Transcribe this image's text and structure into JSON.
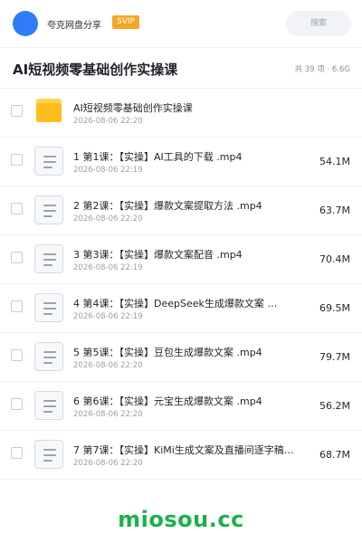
{
  "header": {
    "user_name": "夸克网盘分享",
    "badge": "SVIP",
    "search_placeholder": "搜索"
  },
  "folder": {
    "title": "AI短视频零基础创作实操课",
    "stats": "共 39 项 · 6.6G"
  },
  "items": [
    {
      "type": "folder",
      "name": "AI短视频零基础创作实操课",
      "date": "2026-08-06 22:20",
      "size": ""
    },
    {
      "type": "file",
      "name": "1 第1课：【实操】AI工具的下载 .mp4",
      "date": "2026-08-06 22:19",
      "size": "54.1M"
    },
    {
      "type": "file",
      "name": "2 第2课：【实操】爆款文案提取方法 .mp4",
      "date": "2026-08-06 22:20",
      "size": "63.7M"
    },
    {
      "type": "file",
      "name": "3 第3课：【实操】爆款文案配音 .mp4",
      "date": "2026-08-06 22:19",
      "size": "70.4M"
    },
    {
      "type": "file",
      "name": "4 第4课：【实操】DeepSeek生成爆款文案 …",
      "date": "2026-08-06 22:19",
      "size": "69.5M"
    },
    {
      "type": "file",
      "name": "5 第5课：【实操】豆包生成爆款文案 .mp4",
      "date": "2026-08-06 22:20",
      "size": "79.7M"
    },
    {
      "type": "file",
      "name": "6 第6课：【实操】元宝生成爆款文案 .mp4",
      "date": "2026-08-06 22:20",
      "size": "56.2M"
    },
    {
      "type": "file",
      "name": "7 第7课：【实操】KiMi生成文案及直播间逐字稿…",
      "date": "2026-08-06 22:20",
      "size": "68.7M"
    }
  ],
  "watermark": "miosou.cc",
  "colors": {
    "avatar": "#2f7cf6",
    "badge": "#f5a623",
    "folder": "#ffbe1b",
    "watermark": "#19b24a"
  }
}
